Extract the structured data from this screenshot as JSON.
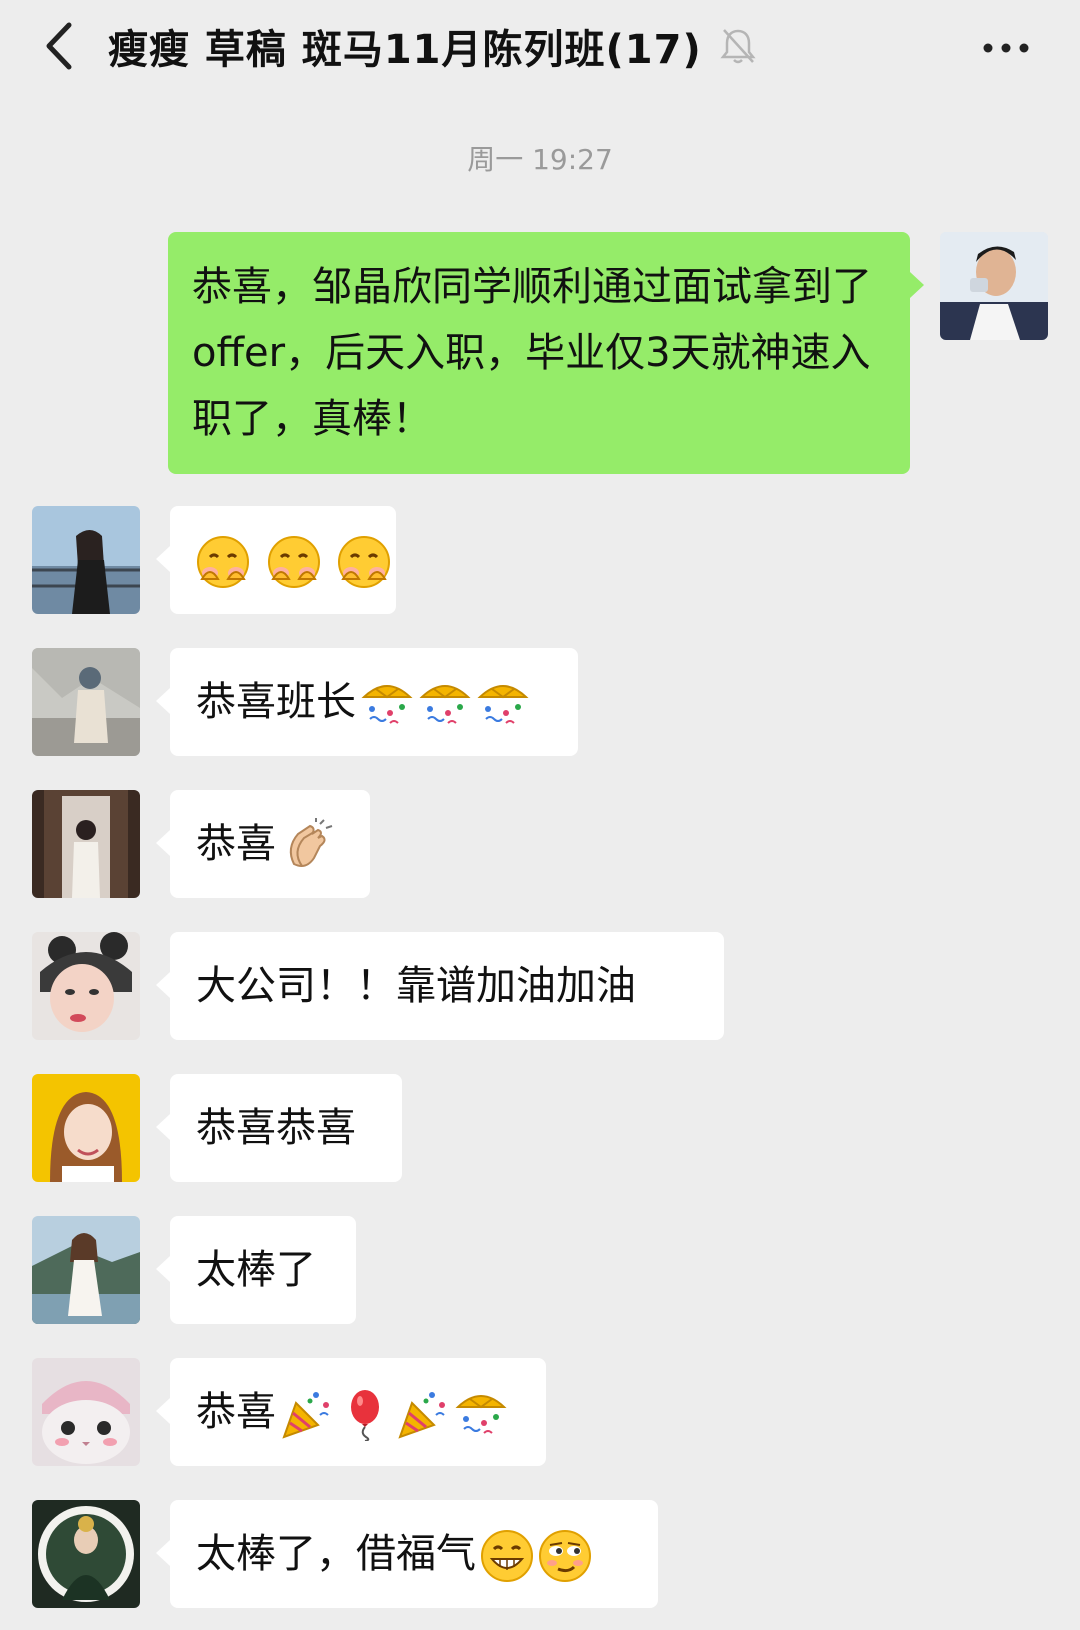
{
  "header": {
    "title": "瘦瘦 草稿 斑马11月陈列班(17)",
    "back_icon": "chevron-left-icon",
    "mute_icon": "bell-off-icon",
    "more_icon": "more-dots-icon"
  },
  "timestamp": "周一 19:27",
  "colors": {
    "background": "#ededed",
    "sent_bubble": "#95ec69",
    "received_bubble": "#ffffff"
  },
  "messages": [
    {
      "side": "right",
      "text": "恭喜，邹晶欣同学顺利通过面试拿到了offer，后天入职，毕业仅3天就神速入职了，真棒！"
    },
    {
      "side": "left",
      "text": "",
      "emojis": [
        "covering-face-emoji",
        "covering-face-emoji",
        "covering-face-emoji"
      ]
    },
    {
      "side": "left",
      "text": "恭喜班长",
      "emojis": [
        "confetti-ball-emoji",
        "confetti-ball-emoji",
        "confetti-ball-emoji"
      ]
    },
    {
      "side": "left",
      "text": "恭喜",
      "emojis": [
        "clapping-hands-emoji"
      ]
    },
    {
      "side": "left",
      "text": "大公司！！靠谱加油加油"
    },
    {
      "side": "left",
      "text": "恭喜恭喜"
    },
    {
      "side": "left",
      "text": "太棒了"
    },
    {
      "side": "left",
      "text": "恭喜",
      "emojis": [
        "party-popper-emoji",
        "balloon-emoji",
        "party-popper-emoji",
        "confetti-ball-emoji"
      ]
    },
    {
      "side": "left",
      "text": "太棒了，借福气",
      "emojis": [
        "grinning-face-emoji",
        "smirking-face-emoji"
      ]
    }
  ]
}
